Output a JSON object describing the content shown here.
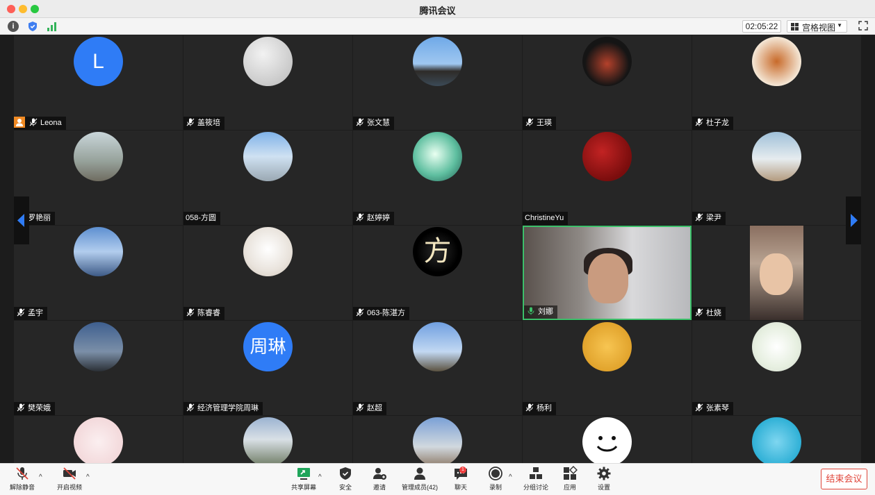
{
  "window": {
    "title": "腾讯会议"
  },
  "toolbar": {
    "timer": "02:05:22",
    "view_mode": "宫格视图"
  },
  "participants": [
    {
      "name": "Leona",
      "avatar_type": "letter",
      "avatar_text": "L",
      "muted": true,
      "host": true
    },
    {
      "name": "盖筱培",
      "avatar_type": "photo",
      "muted": true
    },
    {
      "name": "张文慧",
      "avatar_type": "photo",
      "muted": true
    },
    {
      "name": "王瑛",
      "avatar_type": "photo",
      "muted": true
    },
    {
      "name": "杜子龙",
      "avatar_type": "photo",
      "muted": true
    },
    {
      "name": "罗艳丽",
      "avatar_type": "photo",
      "muted": true
    },
    {
      "name": "058-方圆",
      "avatar_type": "photo",
      "muted": false
    },
    {
      "name": "赵婷婷",
      "avatar_type": "photo",
      "muted": true
    },
    {
      "name": "ChristineYu",
      "avatar_type": "photo",
      "muted": false
    },
    {
      "name": "梁尹",
      "avatar_type": "photo",
      "muted": true
    },
    {
      "name": "孟宇",
      "avatar_type": "photo",
      "muted": true
    },
    {
      "name": "陈睿睿",
      "avatar_type": "photo",
      "muted": true
    },
    {
      "name": "063-陈湛方",
      "avatar_type": "letter",
      "avatar_text": "方",
      "muted": true
    },
    {
      "name": "刘娜",
      "avatar_type": "video",
      "muted": false,
      "speaking": true
    },
    {
      "name": "杜娆",
      "avatar_type": "video-portrait",
      "muted": true
    },
    {
      "name": "樊荣娥",
      "avatar_type": "photo",
      "muted": true
    },
    {
      "name": "经济管理学院周琳",
      "avatar_type": "letter",
      "avatar_text": "周琳",
      "muted": true
    },
    {
      "name": "赵超",
      "avatar_type": "photo",
      "muted": true
    },
    {
      "name": "杨利",
      "avatar_type": "photo",
      "muted": true
    },
    {
      "name": "张素琴",
      "avatar_type": "photo",
      "muted": true
    },
    {
      "name": "",
      "avatar_type": "photo"
    },
    {
      "name": "",
      "avatar_type": "photo"
    },
    {
      "name": "",
      "avatar_type": "photo"
    },
    {
      "name": "",
      "avatar_type": "smiley"
    },
    {
      "name": "",
      "avatar_type": "photo"
    }
  ],
  "bottom_bar": {
    "unmute": "解除静音",
    "start_video": "开启视频",
    "share_screen": "共享屏幕",
    "security": "安全",
    "invite": "邀请",
    "manage_members": "管理成员(42)",
    "chat": "聊天",
    "chat_badge": "1",
    "record": "录制",
    "breakout": "分组讨论",
    "apps": "应用",
    "settings": "设置",
    "end_meeting": "结束会议"
  },
  "colors": {
    "accent_blue": "#2f7cf6",
    "speaking_green": "#3cc06a",
    "end_red": "#e0453a",
    "host_orange": "#f08a24"
  }
}
